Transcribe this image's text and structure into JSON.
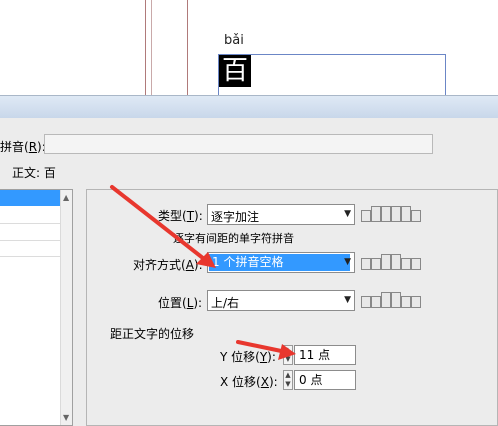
{
  "document": {
    "pinyin_preview": "bǎi",
    "base_char": "百"
  },
  "dialog": {
    "pinyin_label": "拼音(",
    "pinyin_key": "R",
    "pinyin_label_end": "):",
    "base_text_label": "正文: 百",
    "type": {
      "label": "类型(",
      "key": "T",
      "label_end": "):",
      "value": "逐字加注"
    },
    "note": "逐字有间距的单字符拼音",
    "alignment": {
      "label": "对齐方式(",
      "key": "A",
      "label_end": "):",
      "value": "1 个拼音空格"
    },
    "position": {
      "label": "位置(",
      "key": "L",
      "label_end": "):",
      "value": "上/右"
    },
    "offset_group_label": "距正文字的位移",
    "y_offset": {
      "label": "Y 位移(",
      "key": "Y",
      "label_end": "):",
      "value": "11 点"
    },
    "x_offset": {
      "label": "X 位移(",
      "key": "X",
      "label_end": "):",
      "value": "0 点"
    }
  },
  "annotation_color": "#e8372e",
  "selection_color": "#3399ff"
}
